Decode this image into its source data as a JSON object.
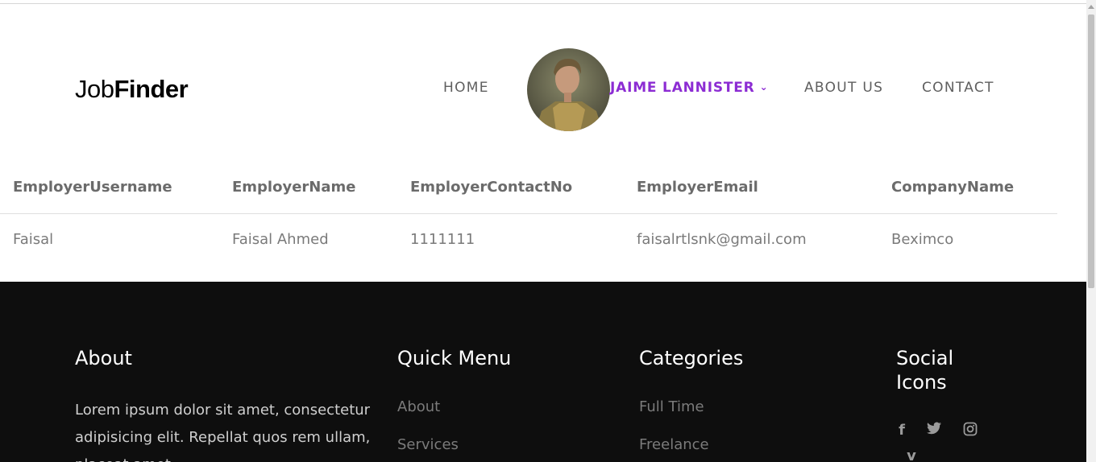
{
  "brand": {
    "logo_light": "Job",
    "logo_bold": "Finder"
  },
  "nav": {
    "home": "HOME",
    "user": "JAIME LANNISTER",
    "about": "ABOUT US",
    "contact": "CONTACT"
  },
  "table": {
    "headers": [
      "EmployerUsername",
      "EmployerName",
      "EmployerContactNo",
      "EmployerEmail",
      "CompanyName"
    ],
    "rows": [
      [
        "Faisal",
        "Faisal Ahmed",
        "1111111",
        "faisalrtlsnk@gmail.com",
        "Beximco"
      ]
    ]
  },
  "footer": {
    "about_title": "About",
    "about_text": "Lorem ipsum dolor sit amet, consectetur adipisicing elit. Repellat quos rem ullam, placeat amet.",
    "quick_title": "Quick Menu",
    "quick_links": [
      "About",
      "Services"
    ],
    "categories_title": "Categories",
    "categories_links": [
      "Full Time",
      "Freelance"
    ],
    "social_title": "Social Icons",
    "social_icons": [
      "facebook-icon",
      "twitter-icon",
      "instagram-icon",
      "vimeo-icon"
    ]
  },
  "colors": {
    "accent": "#8c2cd3",
    "footer_bg": "#0e0e0e"
  }
}
